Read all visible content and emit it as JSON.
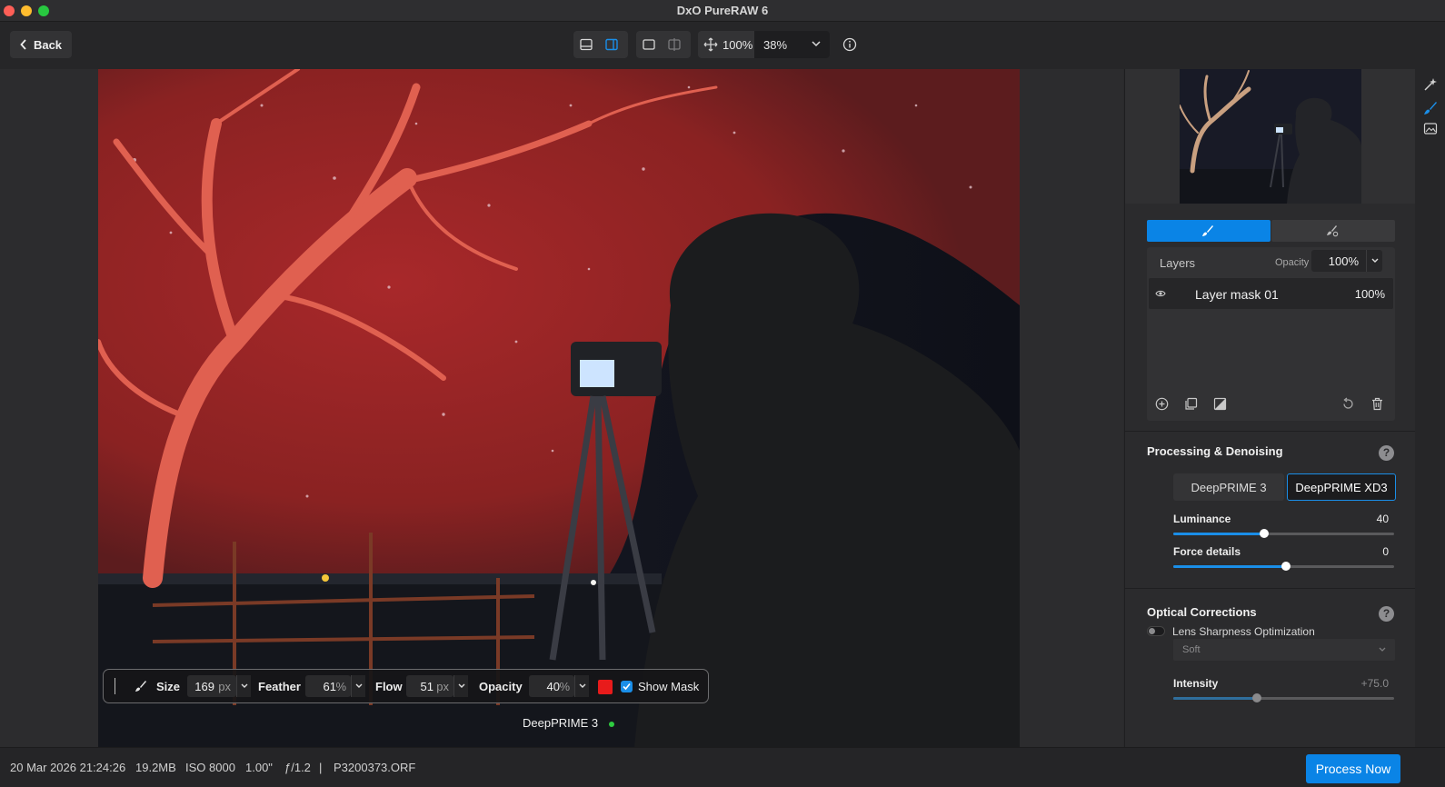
{
  "window": {
    "title": "DxO PureRAW 6",
    "light_colors": [
      "#fe5f57",
      "#febc2e",
      "#28c840"
    ]
  },
  "toolbar": {
    "back_label": "Back",
    "zoom_fit": "100%",
    "zoom_level": "38%"
  },
  "brush_bar": {
    "size_label": "Size",
    "size_value": "169",
    "size_unit": "px",
    "feather_label": "Feather",
    "feather_value": "61",
    "feather_unit": "%",
    "flow_label": "Flow",
    "flow_value": "51",
    "flow_unit": "px",
    "opacity_label": "Opacity",
    "opacity_value": "40",
    "opacity_unit": "%",
    "mask_color": "#e81b1b",
    "show_mask_label": "Show Mask",
    "show_mask_checked": true
  },
  "canvas": {
    "engine_label": "DeepPRIME 3",
    "engine_status_color": "#2ecc40"
  },
  "status_bar": {
    "date": "20 Mar 2026 21:24:26",
    "size": "19.2MB",
    "iso": "ISO 8000",
    "shutter": "1.00\"",
    "aperture": "ƒ/1.2",
    "separator": "|",
    "filename": "P3200373.ORF",
    "process_label": "Process Now"
  },
  "layers": {
    "header": "Layers",
    "opacity_label": "Opacity",
    "opacity_value": "100%",
    "items": [
      {
        "name": "Layer mask 01",
        "opacity": "100%"
      }
    ]
  },
  "processing": {
    "title": "Processing & Denoising",
    "help": "?",
    "engine_options": [
      "DeepPRIME 3",
      "DeepPRIME XD3"
    ],
    "selected_engine": "DeepPRIME XD3",
    "luminance_label": "Luminance",
    "luminance_value": "40",
    "luminance_fraction": 0.41,
    "force_details_label": "Force details",
    "force_details_value": "0",
    "force_details_fraction": 0.51
  },
  "optical": {
    "title": "Optical Corrections",
    "help": "?",
    "lens_label": "Lens Sharpness Optimization",
    "lens_enabled": false,
    "preset_value": "Soft",
    "intensity_label": "Intensity",
    "intensity_value": "+75.0",
    "intensity_fraction": 0.38
  },
  "accent_color": "#0a84e6"
}
